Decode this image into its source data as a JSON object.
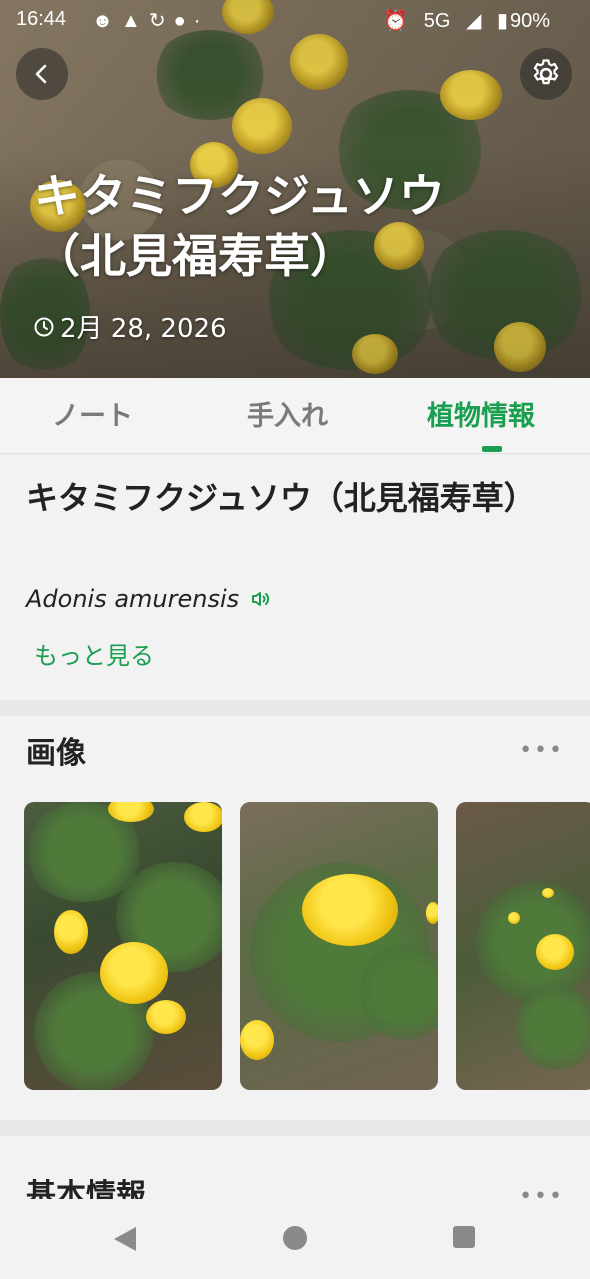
{
  "status_bar": {
    "time": "16:44",
    "left_icons": [
      "person-icon",
      "warning-icon",
      "sync-icon",
      "vpn-icon",
      "dot-icon"
    ],
    "network": "5G",
    "battery": "90%"
  },
  "header": {
    "title": "キタミフクジュソウ（北見福寿草）",
    "date": "2月 28, 2026"
  },
  "tabs": [
    {
      "label": "ノート",
      "active": false
    },
    {
      "label": "手入れ",
      "active": false
    },
    {
      "label": "植物情報",
      "active": true
    }
  ],
  "plant": {
    "name": "キタミフクジュソウ（北見福寿草）",
    "scientific_name": "Adonis amurensis",
    "more_label": "もっと見る"
  },
  "images_section": {
    "title": "画像",
    "more": "•••"
  },
  "basic_info_section": {
    "title": "基本情報",
    "more": "•••"
  },
  "colors": {
    "accent": "#1a9e50",
    "background": "#f2f2f2"
  }
}
